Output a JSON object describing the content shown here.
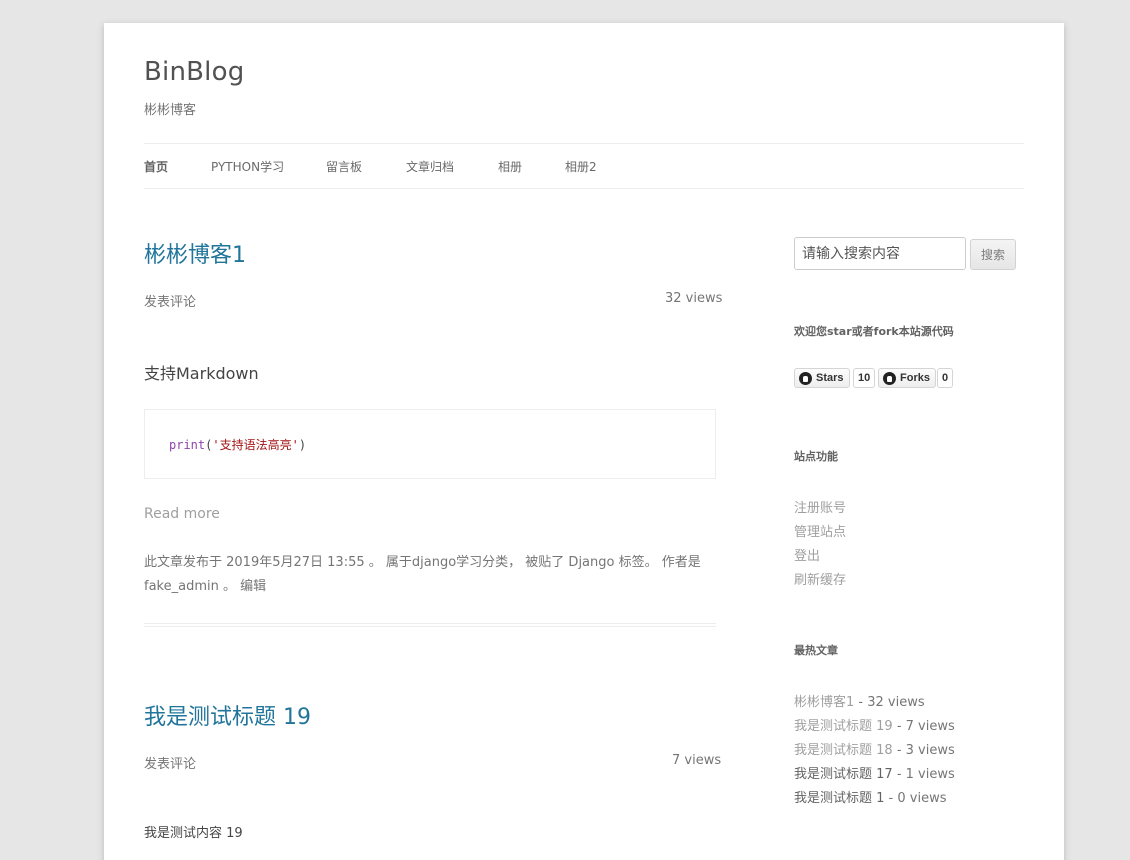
{
  "site": {
    "title": "BinBlog",
    "description": "彬彬博客"
  },
  "nav": {
    "items": [
      {
        "label": "首页"
      },
      {
        "label": "PYTHON学习"
      },
      {
        "label": "留言板"
      },
      {
        "label": "文章归档"
      },
      {
        "label": "相册"
      },
      {
        "label": "相册2"
      }
    ]
  },
  "posts": [
    {
      "title": "彬彬博客1",
      "comment_link": "发表评论",
      "views": "32 views",
      "content_heading": "支持Markdown",
      "code": {
        "fn": "print",
        "open": "(",
        "str": "'支持语法高亮'",
        "close": ")"
      },
      "read_more": "Read more",
      "entry_meta_line1": "此文章发布于 2019年5月27日 13:55 。 属于django学习分类， 被贴了 Django 标签。 作者是",
      "entry_meta_line2": "fake_admin 。 编辑"
    },
    {
      "title": "我是测试标题 19",
      "comment_link": "发表评论",
      "views": "7 views",
      "content": "我是测试内容 19"
    }
  ],
  "sidebar": {
    "search": {
      "placeholder": "请输入搜索内容",
      "button": "搜索"
    },
    "github_widget": {
      "title": "欢迎您star或者fork本站源代码",
      "stars_label": "Stars",
      "stars_count": "10",
      "forks_label": "Forks",
      "forks_count": "0"
    },
    "site_functions": {
      "title": "站点功能",
      "links": [
        "注册账号",
        "管理站点",
        "登出",
        "刷新缓存"
      ]
    },
    "hot_posts": {
      "title": "最热文章",
      "items": [
        {
          "title": "彬彬博客1",
          "views": " - 32 views"
        },
        {
          "title": "我是测试标题 19",
          "views": " - 7 views"
        },
        {
          "title": "我是测试标题 18",
          "views": " - 3 views"
        },
        {
          "title": "我是测试标题 17",
          "views": " - 1 views"
        },
        {
          "title": "我是测试标题 1",
          "views": " - 0 views"
        }
      ]
    }
  }
}
